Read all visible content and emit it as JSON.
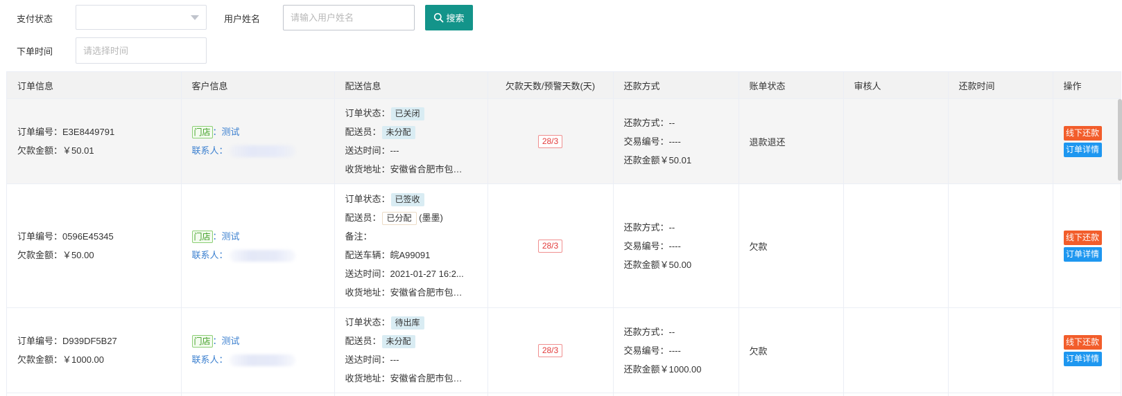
{
  "filters": {
    "pay_status_label": "支付状态",
    "pay_status_value": "",
    "username_label": "用户姓名",
    "username_placeholder": "请输入用户姓名",
    "username_value": "",
    "search_label": "搜索",
    "order_time_label": "下单时间",
    "order_time_placeholder": "请选择时间"
  },
  "table": {
    "headers": {
      "order_info": "订单信息",
      "customer_info": "客户信息",
      "delivery_info": "配送信息",
      "overdue_days": "欠款天数/预警天数(天)",
      "repay_method": "还款方式",
      "bill_status": "账单状态",
      "reviewer": "审核人",
      "repay_time": "还款时间",
      "actions": "操作"
    },
    "labels": {
      "order_no": "订单编号：",
      "debt_amount": "欠款金额：",
      "store_tag": "门店",
      "colon": "：",
      "contact": "联系人：",
      "order_status": "订单状态：",
      "courier": "配送员：",
      "remark": "备注：",
      "vehicle": "配送车辆：",
      "delivery_time": "送达时间：",
      "address": "收货地址：",
      "repay_method": "还款方式：",
      "trade_no": "交易编号：",
      "repay_amount": "还款金额",
      "btn_offline_repay": "线下还款",
      "btn_order_detail": "订单详情"
    },
    "rows": [
      {
        "order_no": "E3E8449791",
        "debt_amount": "￥50.01",
        "store_name": "测试",
        "order_status": "已关闭",
        "courier": "未分配",
        "delivery_time": "---",
        "address": "安徽省合肥市包河区",
        "overdue": "28/3",
        "repay_method": "--",
        "trade_no": "----",
        "repay_amount": "￥50.01",
        "bill_status": "退款退还",
        "reviewer": "",
        "repay_time": ""
      },
      {
        "order_no": "0596E45345",
        "debt_amount": "￥50.00",
        "store_name": "测试",
        "order_status": "已签收",
        "courier": "已分配",
        "courier_name": "(墨墨)",
        "remark": "",
        "vehicle": "皖A99091",
        "delivery_time": "2021-01-27 16:2...",
        "address": "安徽省合肥市包河区",
        "overdue": "28/3",
        "repay_method": "--",
        "trade_no": "----",
        "repay_amount": "￥50.00",
        "bill_status": "欠款",
        "reviewer": "",
        "repay_time": ""
      },
      {
        "order_no": "D939DF5B27",
        "debt_amount": "￥1000.00",
        "store_name": "测试",
        "order_status": "待出库",
        "courier": "未分配",
        "delivery_time": "---",
        "address": "安徽省合肥市包河区",
        "overdue": "28/3",
        "repay_method": "--",
        "trade_no": "----",
        "repay_amount": "￥1000.00",
        "bill_status": "欠款",
        "reviewer": "",
        "repay_time": ""
      }
    ]
  },
  "icons": {
    "search": "search-icon",
    "dropdown": "chevron-down-icon"
  },
  "colors": {
    "primary": "#13948a",
    "offline_btn": "#f25d2b",
    "detail_btn": "#1e97f0",
    "link": "#3a7fcf",
    "warning": "#e23a3a"
  }
}
